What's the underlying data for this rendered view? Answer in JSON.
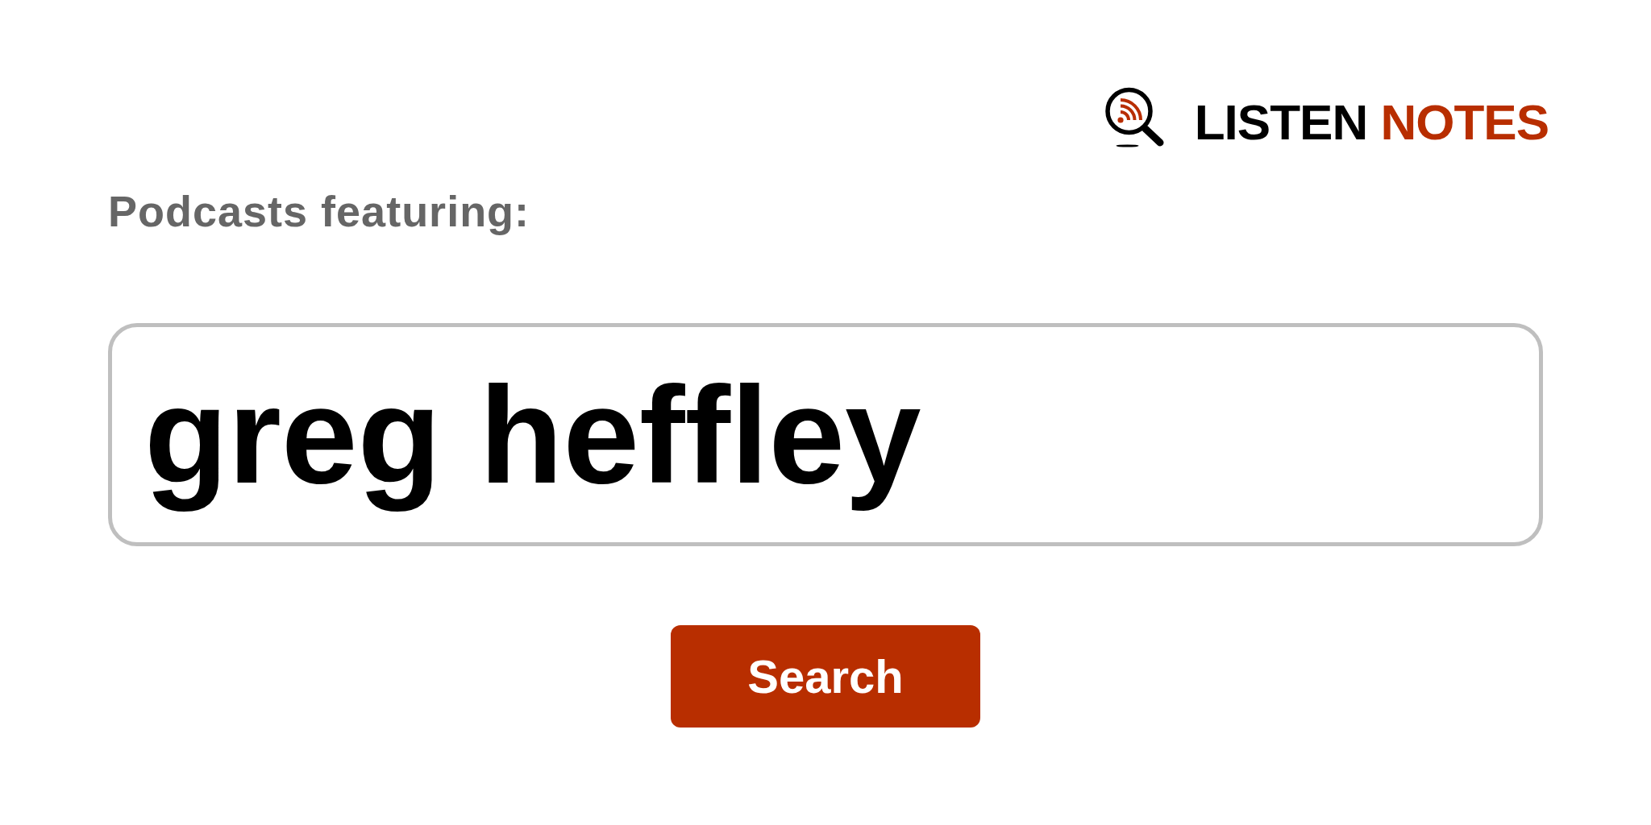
{
  "logo": {
    "words": [
      "LISTEN",
      "NOTES"
    ]
  },
  "heading": "Podcasts featuring:",
  "search_field": {
    "value": "greg heffley"
  },
  "search_button": {
    "label": "Search"
  }
}
